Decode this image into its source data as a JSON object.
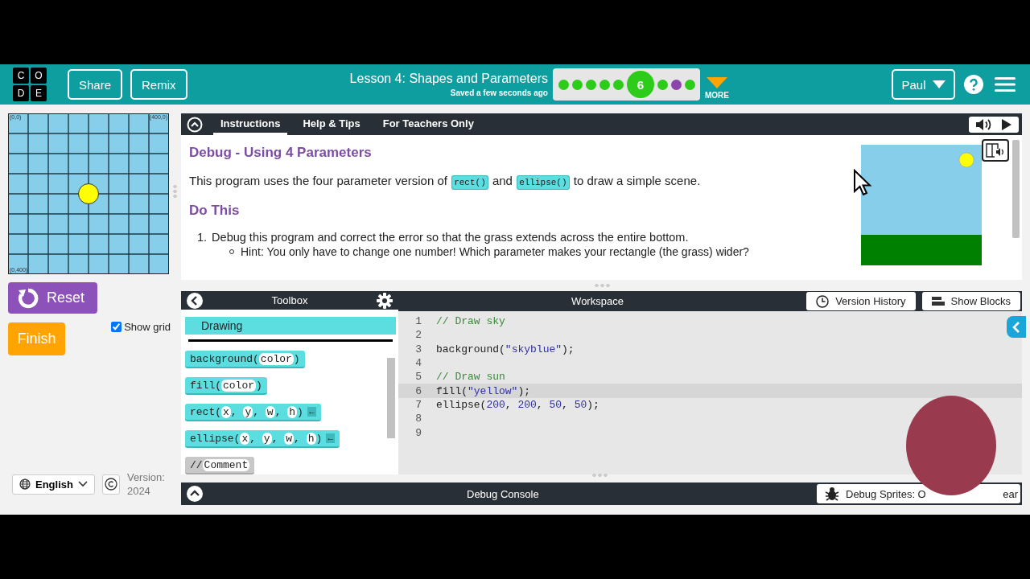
{
  "header": {
    "logo_letters": [
      "C",
      "O",
      "D",
      "E"
    ],
    "buttons": [
      "Share",
      "Remix"
    ],
    "title": "Lesson 4: Shapes and Parameters",
    "saved": "Saved a few seconds ago",
    "progress": [
      {
        "color": "#2ecc1a",
        "selected": false
      },
      {
        "color": "#2ecc1a",
        "selected": false
      },
      {
        "color": "#2ecc1a",
        "selected": false
      },
      {
        "color": "#2ecc1a",
        "selected": false
      },
      {
        "color": "#2ecc1a",
        "selected": false
      },
      {
        "label": "6",
        "color": "#2ecc1a",
        "selected": true
      },
      {
        "color": "#2ecc1a",
        "selected": false
      },
      {
        "color": "#8e44ad",
        "selected": false
      },
      {
        "color": "#2ecc1a",
        "selected": false
      }
    ],
    "more": "MORE",
    "user": "Paul"
  },
  "stage": {
    "corner_labels": [
      "(0,0)",
      "(400,0)",
      "(0,400)"
    ],
    "reset": "Reset",
    "finish": "Finish",
    "show_grid": {
      "label": "Show grid",
      "checked": true
    }
  },
  "footer": {
    "language": "English",
    "version": "Version: 2024"
  },
  "instructions": {
    "tabs": [
      {
        "label": "Instructions",
        "selected": true
      },
      {
        "label": "Help & Tips",
        "selected": false
      },
      {
        "label": "For Teachers Only",
        "selected": false
      }
    ],
    "title": "Debug - Using 4 Parameters",
    "intro": [
      {
        "kind": "text",
        "text": "This program uses the four parameter version of "
      },
      {
        "kind": "code",
        "text": "rect()"
      },
      {
        "kind": "text",
        "text": " and "
      },
      {
        "kind": "code",
        "text": "ellipse()"
      },
      {
        "kind": "text",
        "text": " to draw a simple scene."
      }
    ],
    "heading": "Do This",
    "steps": [
      {
        "number": "1.",
        "text": "Debug this program and correct the error so that the grass extends across the entire bottom.",
        "hints": [
          "Hint: You only have to change one number! Which parameter makes your rectangle (the grass) wider?"
        ]
      }
    ]
  },
  "toolbox": {
    "title": "Toolbox",
    "category": "Drawing",
    "blocks": [
      {
        "kind": "code",
        "tokens": [
          {
            "kind": "text",
            "text": "background("
          },
          {
            "kind": "slot",
            "text": "color"
          },
          {
            "kind": "text",
            "text": ")"
          }
        ]
      },
      {
        "kind": "code",
        "tokens": [
          {
            "kind": "text",
            "text": "fill("
          },
          {
            "kind": "slot",
            "text": "color"
          },
          {
            "kind": "text",
            "text": ")"
          }
        ]
      },
      {
        "kind": "code",
        "tokens": [
          {
            "kind": "text",
            "text": "rect("
          },
          {
            "kind": "slot",
            "text": "x"
          },
          {
            "kind": "text",
            "text": ", "
          },
          {
            "kind": "slot",
            "text": "y"
          },
          {
            "kind": "text",
            "text": ", "
          },
          {
            "kind": "slot",
            "text": "w"
          },
          {
            "kind": "text",
            "text": ", "
          },
          {
            "kind": "slot",
            "text": "h"
          },
          {
            "kind": "text",
            "text": ")"
          },
          {
            "kind": "arrow",
            "text": "←"
          }
        ]
      },
      {
        "kind": "code",
        "tokens": [
          {
            "kind": "text",
            "text": "ellipse("
          },
          {
            "kind": "slot",
            "text": "x"
          },
          {
            "kind": "text",
            "text": ", "
          },
          {
            "kind": "slot",
            "text": "y"
          },
          {
            "kind": "text",
            "text": ", "
          },
          {
            "kind": "slot",
            "text": "w"
          },
          {
            "kind": "text",
            "text": ", "
          },
          {
            "kind": "slot",
            "text": "h"
          },
          {
            "kind": "text",
            "text": ")"
          },
          {
            "kind": "arrow",
            "text": "←"
          }
        ]
      },
      {
        "kind": "comment",
        "tokens": [
          {
            "kind": "text",
            "text": "//"
          },
          {
            "kind": "slot",
            "text": "Comment"
          }
        ]
      }
    ]
  },
  "workspace": {
    "title": "Workspace",
    "buttons": [
      "Version History",
      "Show Blocks"
    ],
    "lines": [
      {
        "number": "1",
        "selected": false,
        "tokens": [
          {
            "kind": "comment",
            "text": "// Draw sky"
          }
        ]
      },
      {
        "number": "2",
        "selected": false
      },
      {
        "number": "3",
        "selected": false,
        "tokens": [
          {
            "kind": "plain",
            "text": "background("
          },
          {
            "kind": "string",
            "text": "\"skyblue\""
          },
          {
            "kind": "plain",
            "text": ");"
          }
        ]
      },
      {
        "number": "4",
        "selected": false
      },
      {
        "number": "5",
        "selected": false,
        "tokens": [
          {
            "kind": "comment",
            "text": "// Draw sun"
          }
        ]
      },
      {
        "number": "6",
        "selected": true,
        "tokens": [
          {
            "kind": "plain",
            "text": "fill("
          },
          {
            "kind": "string",
            "text": "\"yellow\""
          },
          {
            "kind": "plain",
            "text": ");"
          }
        ]
      },
      {
        "number": "7",
        "selected": false,
        "tokens": [
          {
            "kind": "plain",
            "text": "ellipse("
          },
          {
            "kind": "number",
            "text": "200"
          },
          {
            "kind": "plain",
            "text": ", "
          },
          {
            "kind": "number",
            "text": "200"
          },
          {
            "kind": "plain",
            "text": ", "
          },
          {
            "kind": "number",
            "text": "50"
          },
          {
            "kind": "plain",
            "text": ", "
          },
          {
            "kind": "number",
            "text": "50"
          },
          {
            "kind": "plain",
            "text": ");"
          }
        ]
      },
      {
        "number": "8",
        "selected": false
      },
      {
        "number": "9",
        "selected": false
      }
    ]
  },
  "debug": {
    "title": "Debug Console",
    "sprites": "Debug Sprites: O",
    "clear": "ear"
  }
}
